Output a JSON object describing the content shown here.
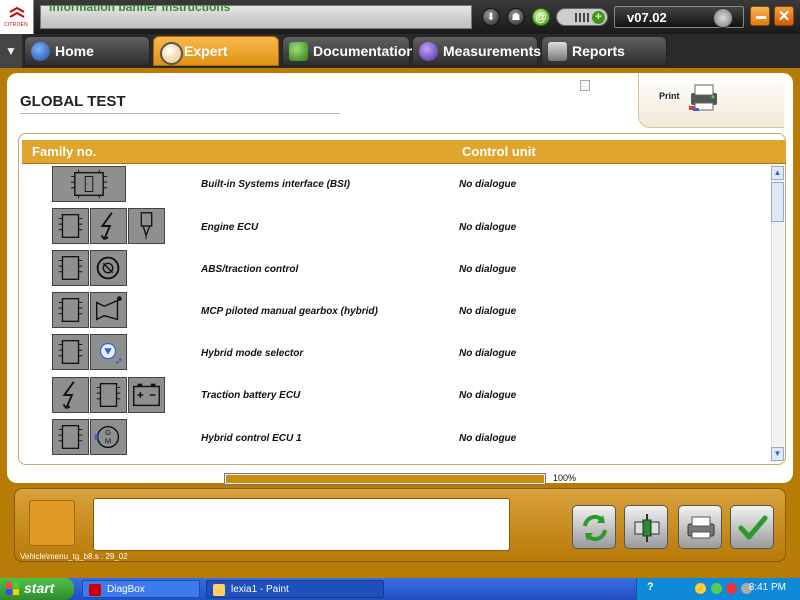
{
  "app": {
    "brand": "CITROËN",
    "info_banner": "Information banner instructions",
    "version": "v07.02"
  },
  "tabs": [
    {
      "label": "Home",
      "active": false
    },
    {
      "label": "Expert",
      "active": true
    },
    {
      "label": "Documentation",
      "active": false
    },
    {
      "label": "Measurements",
      "active": false
    },
    {
      "label": "Reports",
      "active": false
    }
  ],
  "page": {
    "title": "GLOBAL TEST",
    "print_label": "Print"
  },
  "table": {
    "headers": {
      "family": "Family no.",
      "control": "Control unit"
    },
    "rows": [
      {
        "name": "Built-in Systems interface (BSI)",
        "status": "No dialogue",
        "icons": [
          "bsi-module-icon"
        ]
      },
      {
        "name": "Engine ECU",
        "status": "No dialogue",
        "icons": [
          "ecu-chip-icon",
          "lightning-icon",
          "injector-icon"
        ]
      },
      {
        "name": "ABS/traction control",
        "status": "No dialogue",
        "icons": [
          "ecu-chip-icon",
          "abs-icon"
        ]
      },
      {
        "name": "MCP piloted manual gearbox (hybrid)",
        "status": "No dialogue",
        "icons": [
          "ecu-chip-icon",
          "gearbox-icon"
        ]
      },
      {
        "name": "Hybrid mode selector",
        "status": "No dialogue",
        "icons": [
          "ecu-chip-icon",
          "mode-selector-icon"
        ]
      },
      {
        "name": "Traction battery ECU",
        "status": "No dialogue",
        "icons": [
          "lightning-icon",
          "ecu-chip-icon",
          "battery-icon"
        ]
      },
      {
        "name": "Hybrid control ECU 1",
        "status": "No dialogue",
        "icons": [
          "ecu-chip-icon",
          "generator-motor-icon"
        ]
      }
    ]
  },
  "progress": {
    "value": 100,
    "label": "100%"
  },
  "footer": {
    "screen_id": "Vehicle\\menu_tg_b8.s : 29_02"
  },
  "taskbar": {
    "start_label": "start",
    "tasks": [
      {
        "label": "DiagBox"
      },
      {
        "label": "lexia1 - Paint"
      }
    ],
    "clock": "8:41 PM"
  },
  "colors": {
    "accent": "#e0a52e",
    "frame": "#b77c08",
    "tab_active": "#f0a030"
  }
}
